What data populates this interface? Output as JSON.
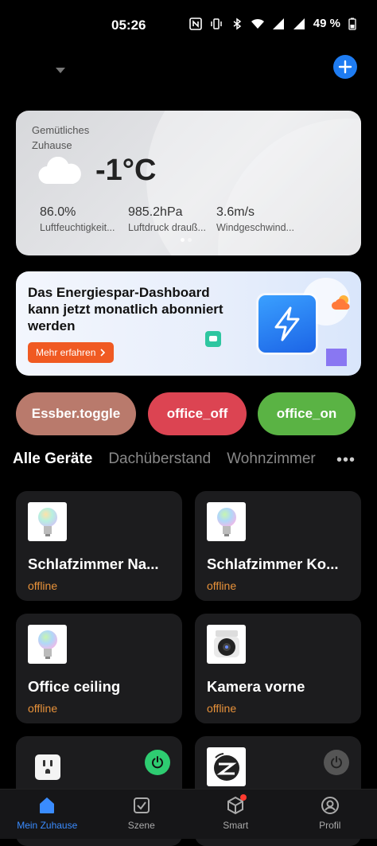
{
  "status_bar": {
    "time": "05:26",
    "battery": "49 %"
  },
  "weather": {
    "home_name": "Gemütliches Zuhause",
    "temperature": "-1°C",
    "stats": [
      {
        "value": "86.0%",
        "label": "Luftfeuchtigkeit..."
      },
      {
        "value": "985.2hPa",
        "label": "Luftdruck drauß..."
      },
      {
        "value": "3.6m/s",
        "label": "Windgeschwind..."
      }
    ]
  },
  "promo": {
    "text": "Das Energiespar-Dashboard kann jetzt monatlich abonniert werden",
    "button_label": "Mehr erfahren"
  },
  "scenes": [
    {
      "label": "Essber.toggle",
      "color": "#b97a6c"
    },
    {
      "label": "office_off",
      "color": "#dc4452"
    },
    {
      "label": "office_on",
      "color": "#5ab344"
    }
  ],
  "tabs": [
    "Alle Geräte",
    "Dachüberstand",
    "Wohnzimmer"
  ],
  "devices": [
    {
      "name": "Schlafzimmer Na...",
      "status": "offline",
      "icon": "bulb-icon"
    },
    {
      "name": "Schlafzimmer Ko...",
      "status": "offline",
      "icon": "bulb-icon"
    },
    {
      "name": "Office ceiling",
      "status": "offline",
      "icon": "bulb-icon"
    },
    {
      "name": "Kamera vorne",
      "status": "offline",
      "icon": "camera-icon"
    },
    {
      "name": "",
      "status": "",
      "icon": "socket-icon",
      "power": "on",
      "power_color": "#2ecc71"
    },
    {
      "name": "",
      "status": "",
      "icon": "zigbee-hub-icon",
      "power": "off",
      "power_color": "#555555"
    }
  ],
  "nav": [
    {
      "label": "Mein Zuhause",
      "icon": "home-icon",
      "active": true
    },
    {
      "label": "Szene",
      "icon": "checkbox-icon",
      "active": false
    },
    {
      "label": "Smart",
      "icon": "cube-icon",
      "active": false
    },
    {
      "label": "Profil",
      "icon": "profile-icon",
      "active": false
    }
  ],
  "colors": {
    "accent": "#1e7cf2",
    "offline": "#e8923a",
    "card": "#1c1c1e"
  }
}
